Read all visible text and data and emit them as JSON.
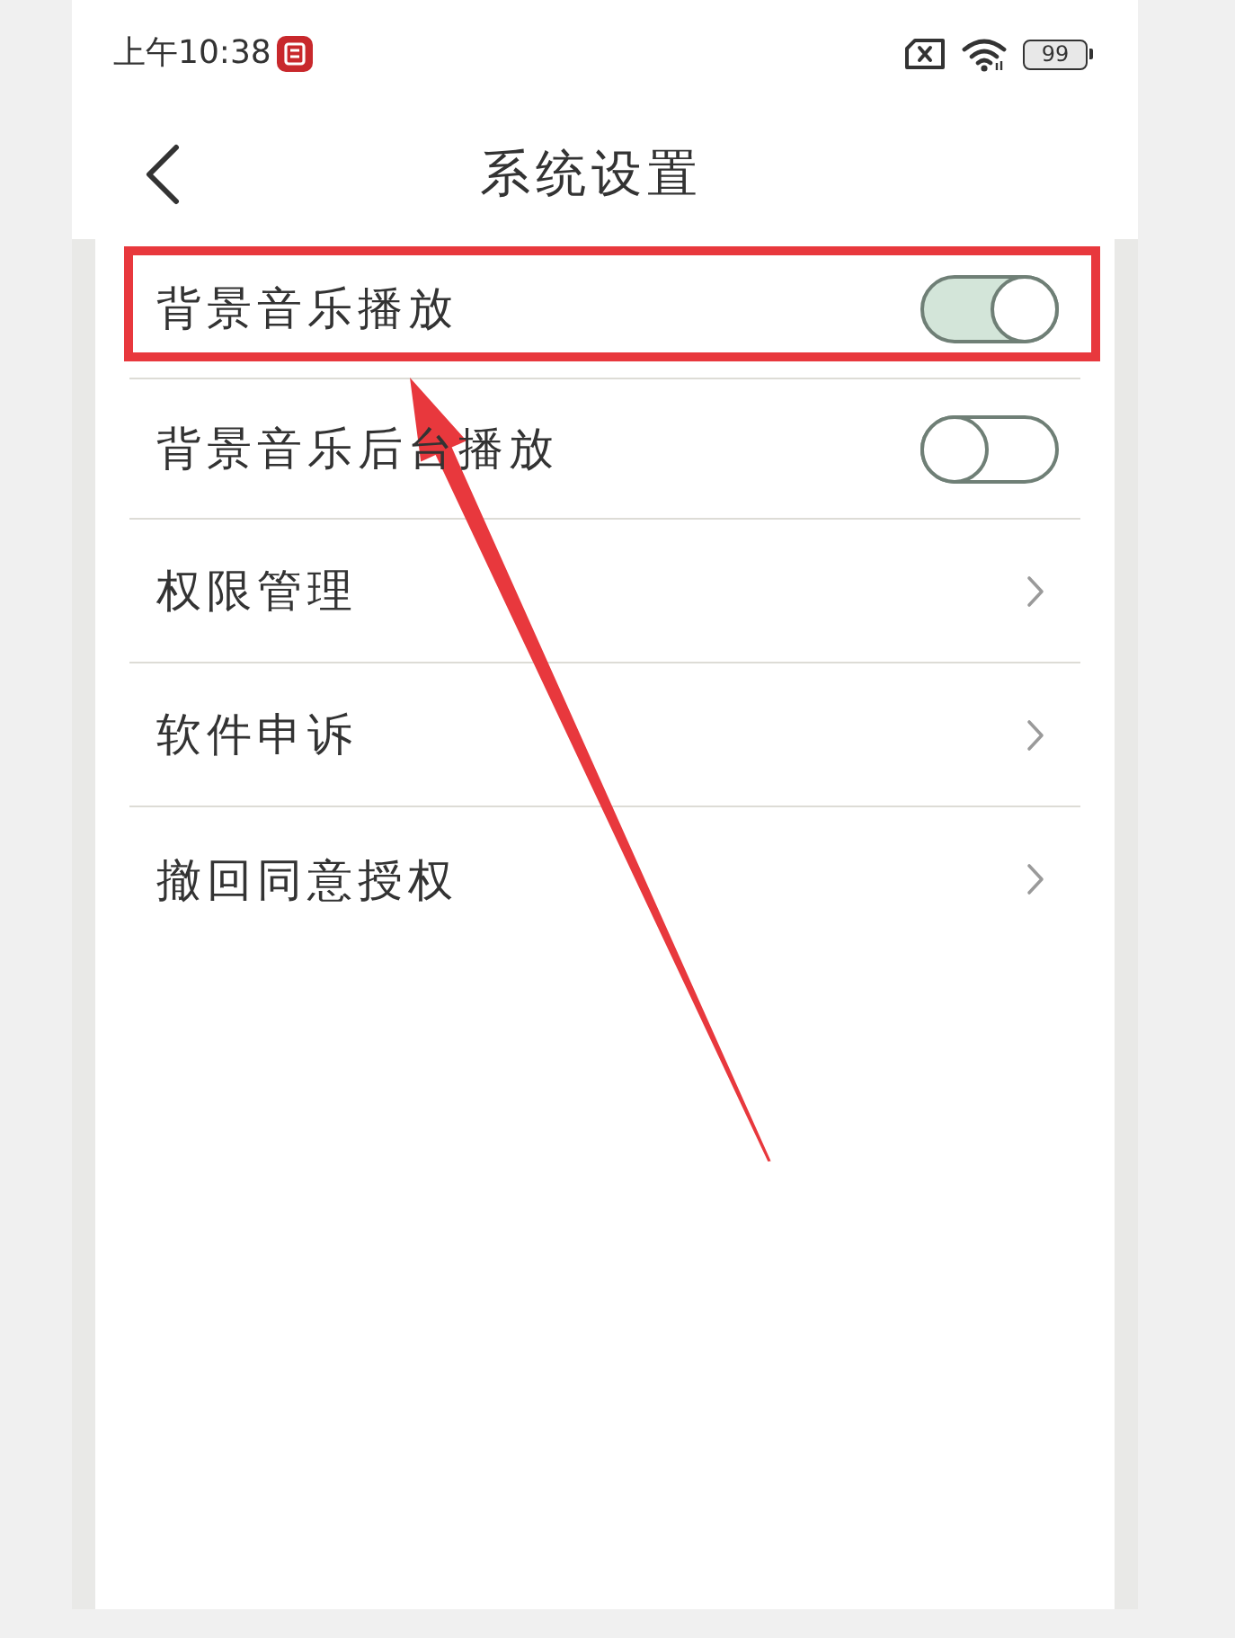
{
  "status_bar": {
    "time": "上午10:38",
    "battery": "99"
  },
  "header": {
    "title": "系统设置"
  },
  "settings": [
    {
      "kind": "toggle",
      "label": "背景音乐播放",
      "on": true,
      "highlighted": true
    },
    {
      "kind": "toggle",
      "label": "背景音乐后台播放",
      "on": false,
      "highlighted": false
    },
    {
      "kind": "link",
      "label": "权限管理",
      "highlighted": false
    },
    {
      "kind": "link",
      "label": "软件申诉",
      "highlighted": false
    },
    {
      "kind": "link",
      "label": "撤回同意授权",
      "highlighted": false
    }
  ]
}
